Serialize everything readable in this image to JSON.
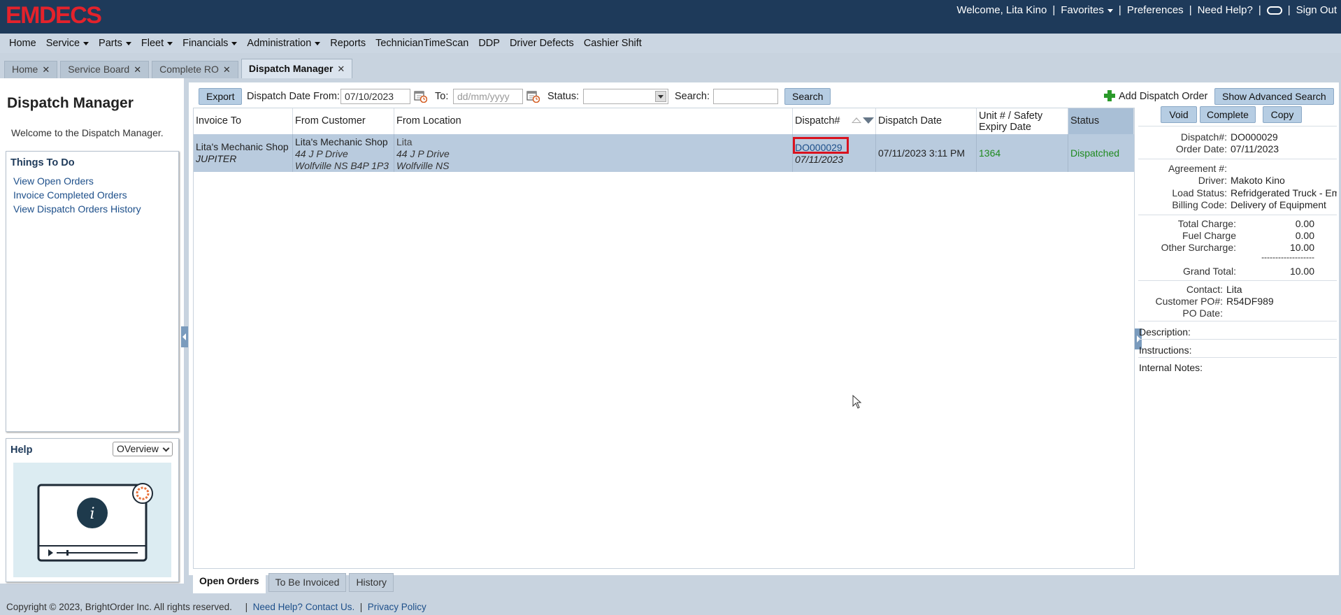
{
  "app": {
    "logo_text": "EMDECS",
    "brand_color": "#e4222b",
    "header_color": "#1e3a5a"
  },
  "topnav": {
    "welcome": "Welcome, Lita Kino",
    "favorites": "Favorites",
    "preferences": "Preferences",
    "need_help": "Need Help?",
    "sign_out": "Sign Out",
    "separator": "|"
  },
  "menu": {
    "items": [
      "Home",
      "Service",
      "Parts",
      "Fleet",
      "Financials",
      "Administration",
      "Reports",
      "TechnicianTimeScan",
      "DDP",
      "Driver Defects",
      "Cashier Shift"
    ]
  },
  "tabs": [
    {
      "label": "Home"
    },
    {
      "label": "Service Board"
    },
    {
      "label": "Complete RO"
    },
    {
      "label": "Dispatch Manager"
    }
  ],
  "left_panel": {
    "title": "Dispatch Manager",
    "welcome": "Welcome to the Dispatch Manager.",
    "todo_title": "Things To Do",
    "todo_links": [
      "View Open Orders",
      "Invoice Completed Orders",
      "View Dispatch Orders History"
    ],
    "help_title": "Help",
    "help_select": "OVerview"
  },
  "toolbar": {
    "export": "Export",
    "date_from_label": "Dispatch Date From:",
    "date_from_value": "07/10/2023",
    "to_label": "To:",
    "to_placeholder": "dd/mm/yyyy",
    "status_label": "Status:",
    "status_value": "",
    "search_label": "Search:",
    "search_value": "",
    "search_button": "Search",
    "add_order": "Add Dispatch Order",
    "advanced_search": "Show Advanced Search"
  },
  "table": {
    "columns": [
      "Invoice To",
      "From Customer",
      "From Location",
      "Dispatch#",
      "Dispatch Date",
      "Unit # / Safety Expiry Date",
      "Status"
    ],
    "rows": [
      {
        "invoice_to": "Lita's Mechanic Shop",
        "invoice_to_sub": "JUPITER",
        "from_customer": "Lita's Mechanic Shop",
        "from_customer_addr1": "44 J P Drive",
        "from_customer_addr2": "Wolfville NS B4P 1P3",
        "from_location": "Lita",
        "from_location_addr1": "44 J P Drive",
        "from_location_addr2": "Wolfville NS",
        "dispatch_no": "DO000029",
        "dispatch_sub_date": "07/11/2023",
        "dispatch_date": "07/11/2023 3:11 PM",
        "unit": "1364",
        "status": "Dispatched"
      }
    ]
  },
  "bottom_tabs": [
    "Open Orders",
    "To Be Invoiced",
    "History"
  ],
  "details": {
    "void": "Void",
    "complete": "Complete",
    "copy": "Copy",
    "dispatch_label": "Dispatch#:",
    "dispatch_value": "DO000029",
    "order_date_label": "Order Date:",
    "order_date_value": "07/11/2023",
    "agreement_label": "Agreement #:",
    "driver_label": "Driver:",
    "driver_value": "Makoto Kino",
    "load_status_label": "Load Status:",
    "load_status_value": "Refridgerated Truck - Em",
    "billing_code_label": "Billing Code:",
    "billing_code_value": "Delivery of Equipment",
    "total_charge_label": "Total Charge:",
    "total_charge_value": "0.00",
    "fuel_charge_label": "Fuel Charge",
    "fuel_charge_value": "0.00",
    "other_surcharge_label": "Other Surcharge:",
    "other_surcharge_value": "10.00",
    "dashes": "-------------------",
    "grand_total_label": "Grand Total:",
    "grand_total_value": "10.00",
    "contact_label": "Contact:",
    "contact_value": "Lita",
    "customer_po_label": "Customer PO#:",
    "customer_po_value": "R54DF989",
    "po_date_label": "PO Date:",
    "description_label": "Description:",
    "instructions_label": "Instructions:",
    "internal_notes_label": "Internal Notes:"
  },
  "footer": {
    "copyright": "Copyright © 2023, BrightOrder Inc. All rights reserved.",
    "sep": "|",
    "help_link": "Need Help? Contact Us.",
    "privacy": "Privacy Policy"
  }
}
